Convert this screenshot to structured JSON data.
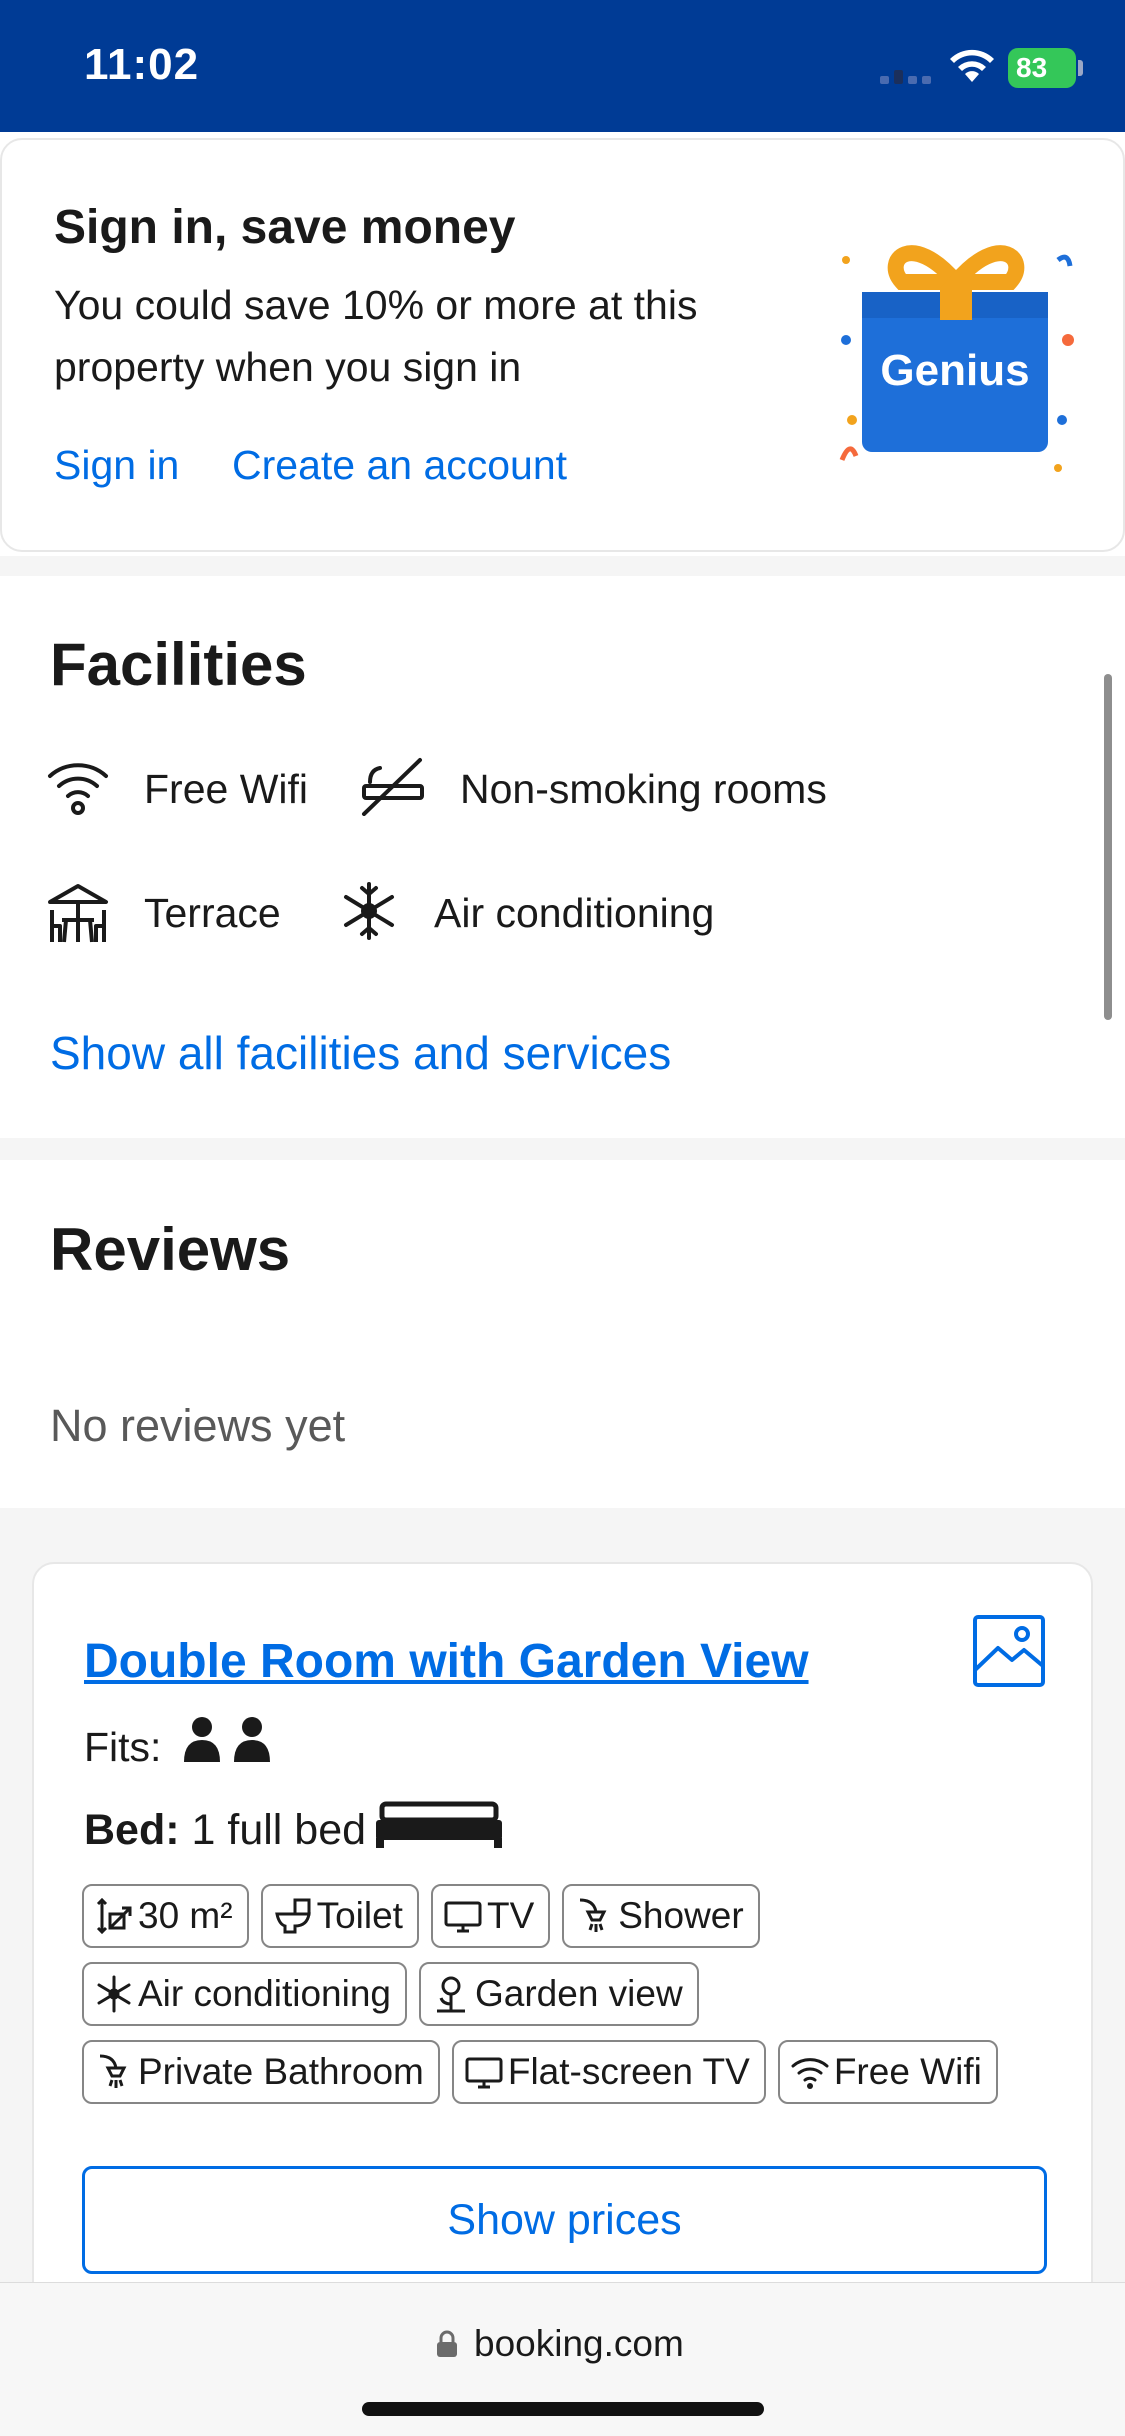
{
  "status_bar": {
    "time": "11:02",
    "battery": "83"
  },
  "signin_card": {
    "title": "Sign in, save money",
    "body": "You could save 10% or more at this property when you sign in",
    "sign_in_link": "Sign in",
    "create_account_link": "Create an account",
    "genius_label": "Genius"
  },
  "facilities": {
    "title": "Facilities",
    "items": [
      {
        "label": "Free Wifi",
        "icon": "wifi-icon"
      },
      {
        "label": "Non-smoking rooms",
        "icon": "no-smoking-icon"
      },
      {
        "label": "Terrace",
        "icon": "terrace-icon"
      },
      {
        "label": "Air conditioning",
        "icon": "snowflake-icon"
      }
    ],
    "show_all_link": "Show all facilities and services"
  },
  "reviews": {
    "title": "Reviews",
    "empty_text": "No reviews yet"
  },
  "room": {
    "title": "Double Room with Garden View",
    "fits_label": "Fits:",
    "fits_guests": 2,
    "bed_label": "Bed:",
    "bed_value": "1 full bed",
    "tags": [
      {
        "label": "30 m²",
        "icon": "room-size-icon"
      },
      {
        "label": "Toilet",
        "icon": "toilet-icon"
      },
      {
        "label": "TV",
        "icon": "tv-icon"
      },
      {
        "label": "Shower",
        "icon": "shower-icon"
      },
      {
        "label": "Air conditioning",
        "icon": "snowflake-icon"
      },
      {
        "label": "Garden view",
        "icon": "garden-icon"
      },
      {
        "label": "Private Bathroom",
        "icon": "bathroom-icon"
      },
      {
        "label": "Flat-screen TV",
        "icon": "flat-screen-tv-icon"
      },
      {
        "label": "Free Wifi",
        "icon": "wifi-icon"
      }
    ],
    "show_prices_button": "Show prices"
  },
  "browser": {
    "url": "booking.com"
  },
  "colors": {
    "brand_blue": "#003b95",
    "link_blue": "#006ce4",
    "battery_green": "#34c759"
  }
}
